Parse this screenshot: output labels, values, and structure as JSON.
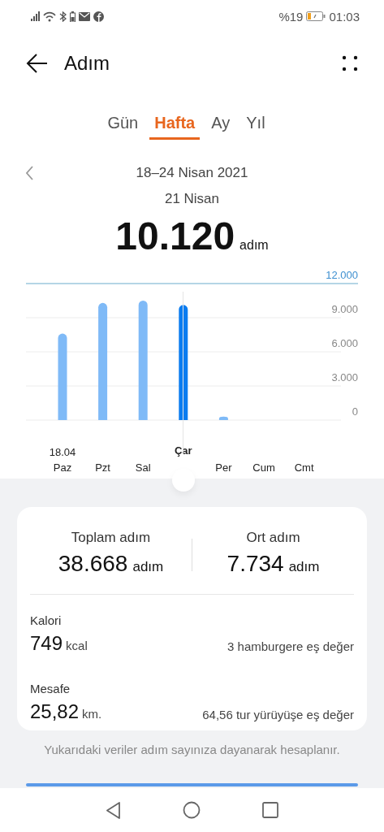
{
  "status_bar": {
    "battery": "%19",
    "time": "01:03"
  },
  "header": {
    "title": "Adım"
  },
  "tabs": [
    {
      "label": "Gün",
      "selected": false
    },
    {
      "label": "Hafta",
      "selected": true
    },
    {
      "label": "Ay",
      "selected": false
    },
    {
      "label": "Yıl",
      "selected": false
    }
  ],
  "period": {
    "label": "18–24 Nisan 2021"
  },
  "summary": {
    "date": "21 Nisan",
    "value": "10.120",
    "unit": "adım"
  },
  "chart": {
    "first_date": "18.04",
    "selected_days": [
      false,
      false,
      false,
      true,
      false,
      false,
      false
    ],
    "chart_data": {
      "type": "bar",
      "categories": [
        "Paz",
        "Pzt",
        "Sal",
        "Çar",
        "Per",
        "Cum",
        "Cmt"
      ],
      "values": [
        7600,
        10300,
        10500,
        10120,
        300,
        null,
        null
      ],
      "grid": true,
      "ylim": [
        0,
        12000
      ],
      "yticks": [
        {
          "value": 0,
          "label": "0"
        },
        {
          "value": 3000,
          "label": "3.000"
        },
        {
          "value": 6000,
          "label": "6.000"
        },
        {
          "value": 9000,
          "label": "9.000"
        },
        {
          "value": 12000,
          "label": "12.000"
        }
      ]
    }
  },
  "totals": [
    {
      "label": "Toplam adım",
      "value": "38.668",
      "unit": "adım"
    },
    {
      "label": "Ort adım",
      "value": "7.734",
      "unit": "adım"
    }
  ],
  "metrics": [
    {
      "label": "Kalori",
      "value": "749",
      "unit": "kcal",
      "note": "3 hamburgere eş değer"
    },
    {
      "label": "Mesafe",
      "value": "25,82",
      "unit": "km.",
      "note": "64,56 tur yürüyüşe eş değer"
    }
  ],
  "footnote": "Yukarıdaki veriler adım sayınıza dayanarak hesaplanır."
}
